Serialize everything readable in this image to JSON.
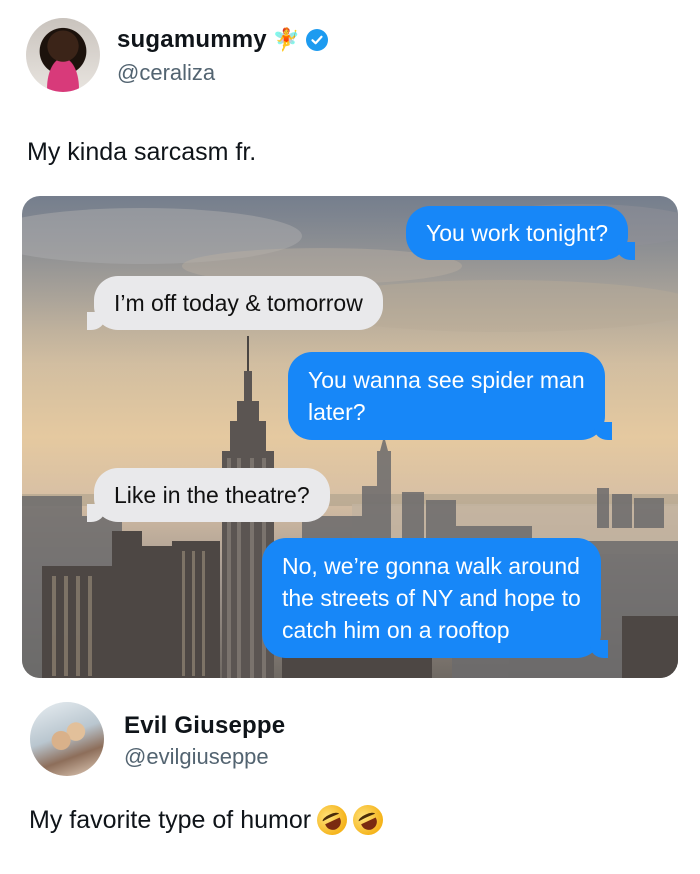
{
  "posts": [
    {
      "display_name": "sugamummy",
      "name_emoji": "🧚",
      "handle": "@ceraliza",
      "verified": true,
      "text": "My kinda sarcasm fr.",
      "messages": [
        {
          "direction": "sent",
          "lines": [
            "You work tonight?"
          ]
        },
        {
          "direction": "received",
          "lines": [
            "I’m off today & tomorrow"
          ]
        },
        {
          "direction": "sent",
          "lines": [
            "You wanna see spider man",
            "later?"
          ]
        },
        {
          "direction": "received",
          "lines": [
            "Like in the theatre?"
          ]
        },
        {
          "direction": "sent",
          "lines": [
            "No, we’re gonna walk around",
            "the streets of NY and hope to",
            "catch him on a rooftop"
          ]
        }
      ]
    },
    {
      "display_name": "Evil Giuseppe",
      "handle": "@evilgiuseppe",
      "text": "My favorite type of humor",
      "emojis": [
        "rolling-on-floor-laughing-icon",
        "rolling-on-floor-laughing-icon"
      ]
    }
  ],
  "colors": {
    "sent_bubble": "#1787f8",
    "received_bubble": "#e9e9eb",
    "verified_badge": "#1d9bf0",
    "handle_text": "#536471"
  }
}
